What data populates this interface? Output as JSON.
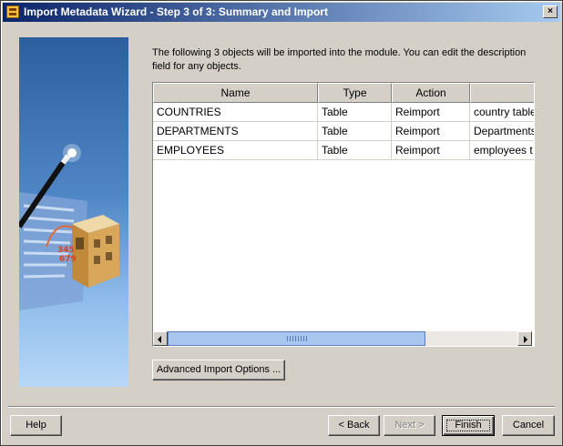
{
  "window": {
    "title": "Import Metadata Wizard - Step 3 of 3: Summary and Import",
    "close_label": "×"
  },
  "description": "The following 3 objects will be imported into the module. You can edit the description field for any objects.",
  "table": {
    "columns": [
      "Name",
      "Type",
      "Action",
      ""
    ],
    "rows": [
      [
        "COUNTRIES",
        "Table",
        "Reimport",
        "country table"
      ],
      [
        "DEPARTMENTS",
        "Table",
        "Reimport",
        "Departments"
      ],
      [
        "EMPLOYEES",
        "Table",
        "Reimport",
        "employees t"
      ]
    ]
  },
  "buttons": {
    "advanced": "Advanced Import Options ...",
    "help": "Help",
    "back": "< Back",
    "next": "Next >",
    "finish": "Finish",
    "cancel": "Cancel"
  },
  "colors": {
    "title_gradient_start": "#0a246a",
    "title_gradient_end": "#a6caf0",
    "face": "#d4d0c8",
    "scroll_thumb": "#a9c6ee"
  },
  "icons": {
    "title": "wizard-app-icon",
    "side_art": "wizard-wand-building-illustration"
  }
}
